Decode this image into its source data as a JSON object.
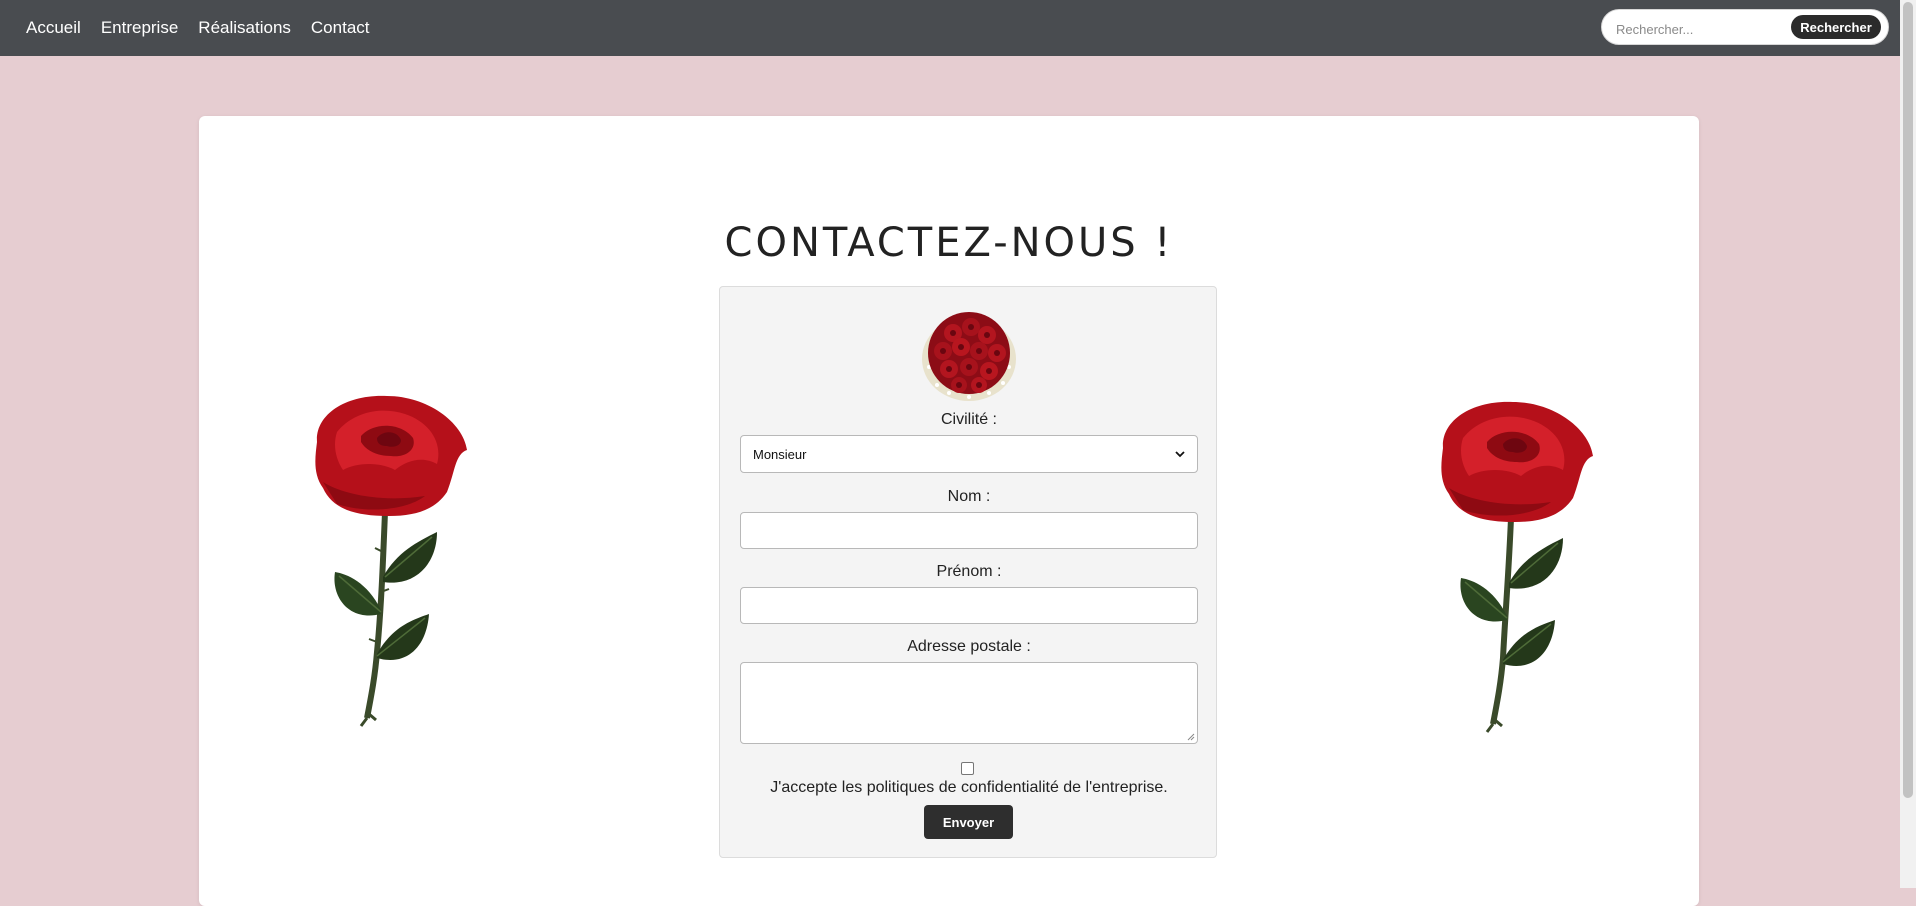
{
  "nav": {
    "items": [
      {
        "label": "Accueil"
      },
      {
        "label": "Entreprise"
      },
      {
        "label": "Réalisations"
      },
      {
        "label": "Contact"
      }
    ],
    "search": {
      "placeholder": "Rechercher...",
      "button_label": "Rechercher"
    }
  },
  "page": {
    "title": "CONTACTEZ-NOUS !"
  },
  "form": {
    "civility_label": "Civilité :",
    "civility_value": "Monsieur",
    "nom_label": "Nom :",
    "prenom_label": "Prénom :",
    "address_label": "Adresse postale :",
    "consent_text": "J'accepte les politiques de confidentialité de l'entreprise.",
    "submit_label": "Envoyer"
  },
  "colors": {
    "background": "#e6cdd1",
    "navbar": "#494c50",
    "button_dark": "#2e2e2e",
    "rose_red": "#c4121a",
    "leaf_green": "#2f4a22"
  },
  "icons": {
    "dropdown": "chevron-down-icon",
    "rose": "rose-illustration",
    "bouquet": "rose-bouquet-illustration"
  }
}
